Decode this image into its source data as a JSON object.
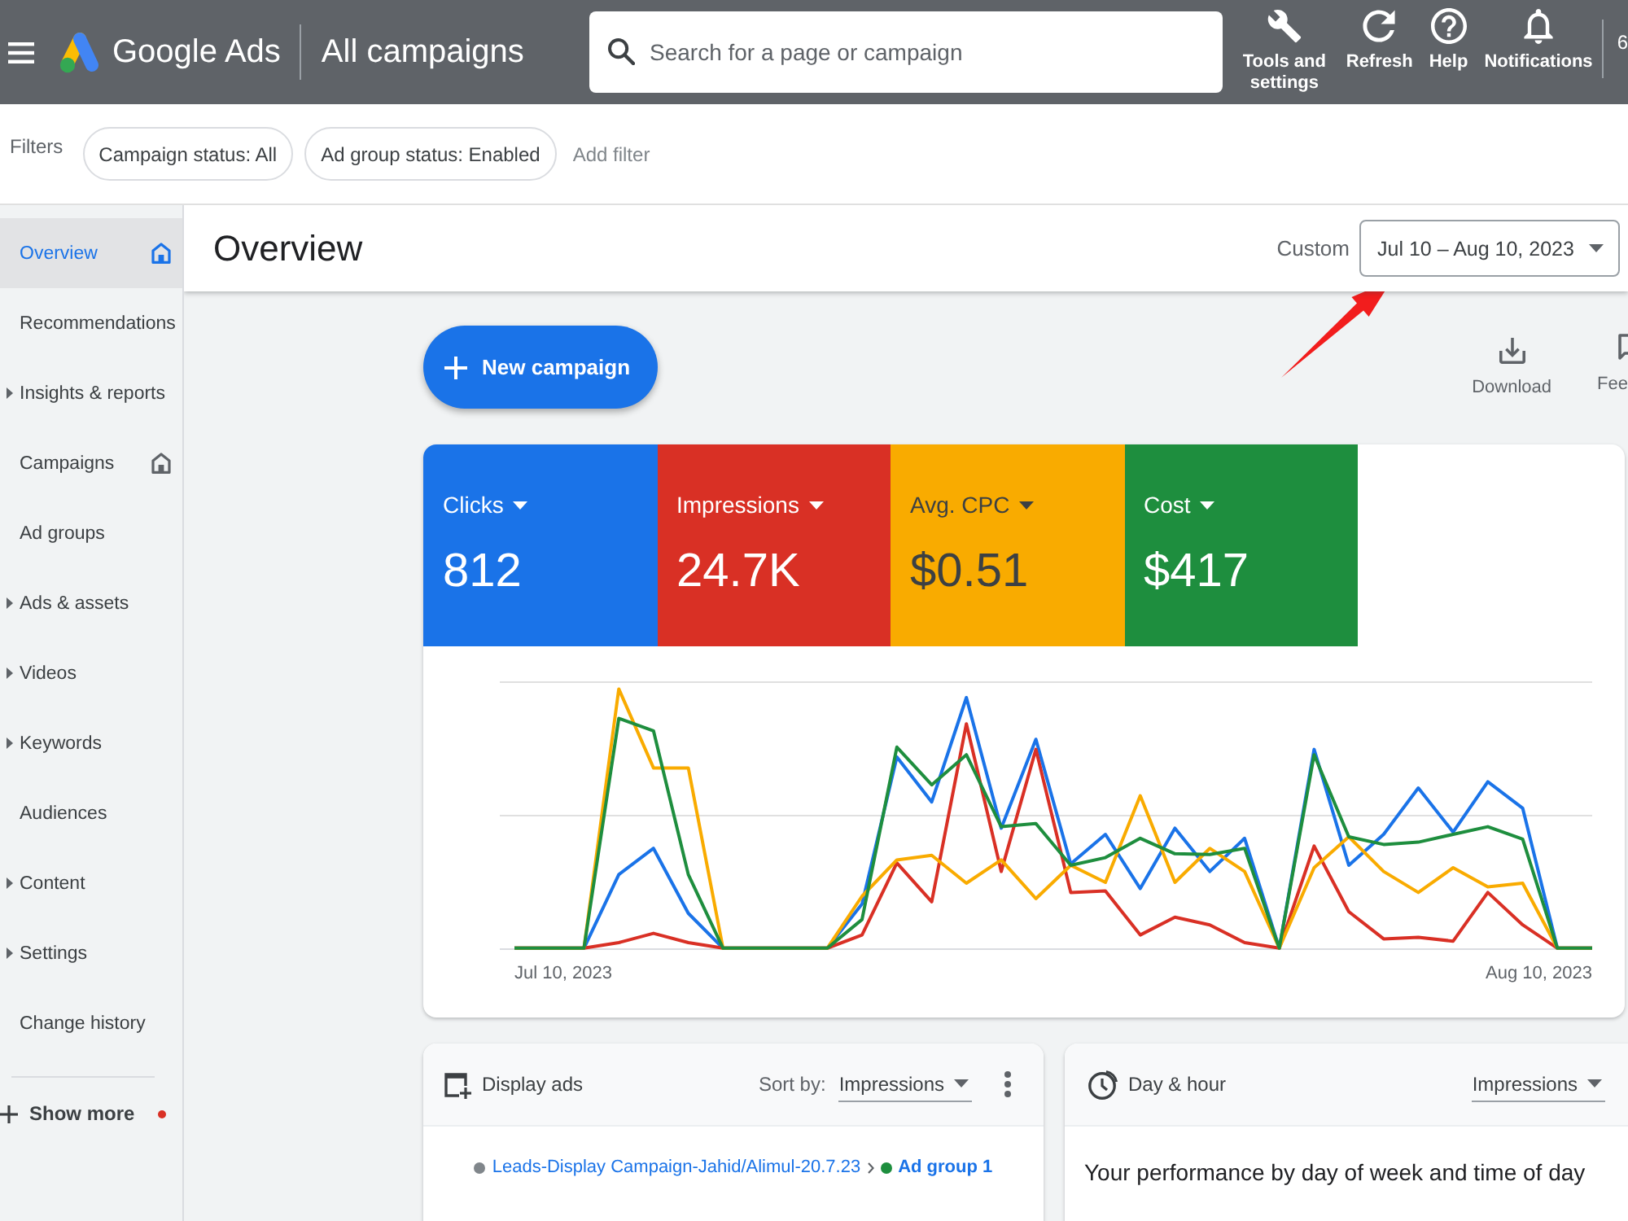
{
  "top_bar": {
    "product": "Google Ads",
    "title": "All campaigns",
    "search": {
      "placeholder": "Search for a page or campaign"
    },
    "actions": [
      {
        "kind": "tools",
        "label": "Tools and settings"
      },
      {
        "kind": "refresh",
        "label": "Refresh"
      },
      {
        "kind": "help",
        "label": "Help"
      },
      {
        "kind": "notifications",
        "label": "Notifications"
      }
    ],
    "account_id": "6"
  },
  "filters": {
    "label": "Filters",
    "chips": [
      "Campaign status: All",
      "Ad group status: Enabled"
    ],
    "add_filter": "Add filter"
  },
  "sidebar": {
    "items": [
      {
        "label": "Overview",
        "selected": true,
        "expandable": false,
        "home": true
      },
      {
        "label": "Recommendations",
        "selected": false,
        "expandable": false,
        "home": false
      },
      {
        "label": "Insights & reports",
        "selected": false,
        "expandable": true,
        "home": false
      },
      {
        "label": "Campaigns",
        "selected": false,
        "expandable": false,
        "home": true
      },
      {
        "label": "Ad groups",
        "selected": false,
        "expandable": false,
        "home": false
      },
      {
        "label": "Ads & assets",
        "selected": false,
        "expandable": true,
        "home": false
      },
      {
        "label": "Videos",
        "selected": false,
        "expandable": true,
        "home": false
      },
      {
        "label": "Keywords",
        "selected": false,
        "expandable": true,
        "home": false
      },
      {
        "label": "Audiences",
        "selected": false,
        "expandable": false,
        "home": false
      },
      {
        "label": "Content",
        "selected": false,
        "expandable": true,
        "home": false
      },
      {
        "label": "Settings",
        "selected": false,
        "expandable": true,
        "home": false
      },
      {
        "label": "Change history",
        "selected": false,
        "expandable": false,
        "home": false
      }
    ],
    "show_more": {
      "label": "Show more",
      "alert": true
    }
  },
  "page_header": {
    "title": "Overview",
    "range_label": "Custom",
    "date_range": "Jul 10 – Aug 10, 2023"
  },
  "toolbar": {
    "new_campaign": "New campaign",
    "actions": [
      {
        "kind": "download",
        "label": "Download"
      },
      {
        "kind": "feedback",
        "label": "Fee"
      }
    ]
  },
  "metrics": [
    {
      "label": "Clicks",
      "value": "812",
      "color": "#1a73e8"
    },
    {
      "label": "Impressions",
      "value": "24.7K",
      "color": "#d93025"
    },
    {
      "label": "Avg. CPC",
      "value": "$0.51",
      "color": "#f9ab00"
    },
    {
      "label": "Cost",
      "value": "$417",
      "color": "#1e8e3e"
    }
  ],
  "chart": {
    "x_start": "Jul 10, 2023",
    "x_end": "Aug 10, 2023"
  },
  "display_ads_card": {
    "title": "Display ads",
    "sort_label": "Sort by:",
    "sort_value": "Impressions",
    "breadcrumb": [
      {
        "kind": "campaign",
        "text": "Leads-Display Campaign-Jahid/Alimul-20.7.23",
        "color": "#80868b"
      },
      {
        "kind": "ad_group",
        "text": "Ad group 1",
        "color": "#1e8e3e"
      }
    ]
  },
  "day_hour_card": {
    "title": "Day & hour",
    "sort_value": "Impressions",
    "description": "Your performance by day of week and time of day"
  }
}
